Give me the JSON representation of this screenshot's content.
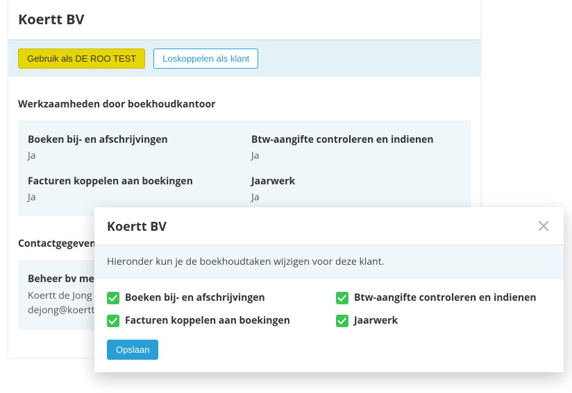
{
  "page": {
    "title": "Koertt BV",
    "actions": {
      "use_as": "Gebruik als DE ROO TEST",
      "unlink": "Loskoppelen als klant"
    },
    "tasks_section_heading": "Werkzaamheden door boekhoudkantoor",
    "tasks": [
      {
        "label": "Boeken bij- en afschrijvingen",
        "value": "Ja"
      },
      {
        "label": "Btw-aangifte controleren en indienen",
        "value": "Ja"
      },
      {
        "label": "Facturen koppelen aan boekingen",
        "value": "Ja"
      },
      {
        "label": "Jaarwerk",
        "value": "Ja"
      }
    ],
    "contact_section_heading": "Contactgegevens",
    "contact": {
      "label": "Beheer bv medewerker",
      "name": "Koertt de Jong",
      "email": "dejong@koertt"
    }
  },
  "modal": {
    "title": "Koertt BV",
    "banner": "Hieronder kun je de boekhoudtaken wijzigen voor deze klant.",
    "checkboxes": [
      {
        "label": "Boeken bij- en afschrijvingen",
        "checked": true
      },
      {
        "label": "Btw-aangifte controleren en indienen",
        "checked": true
      },
      {
        "label": "Facturen koppelen aan boekingen",
        "checked": true
      },
      {
        "label": "Jaarwerk",
        "checked": true
      }
    ],
    "save_label": "Opslaan"
  }
}
